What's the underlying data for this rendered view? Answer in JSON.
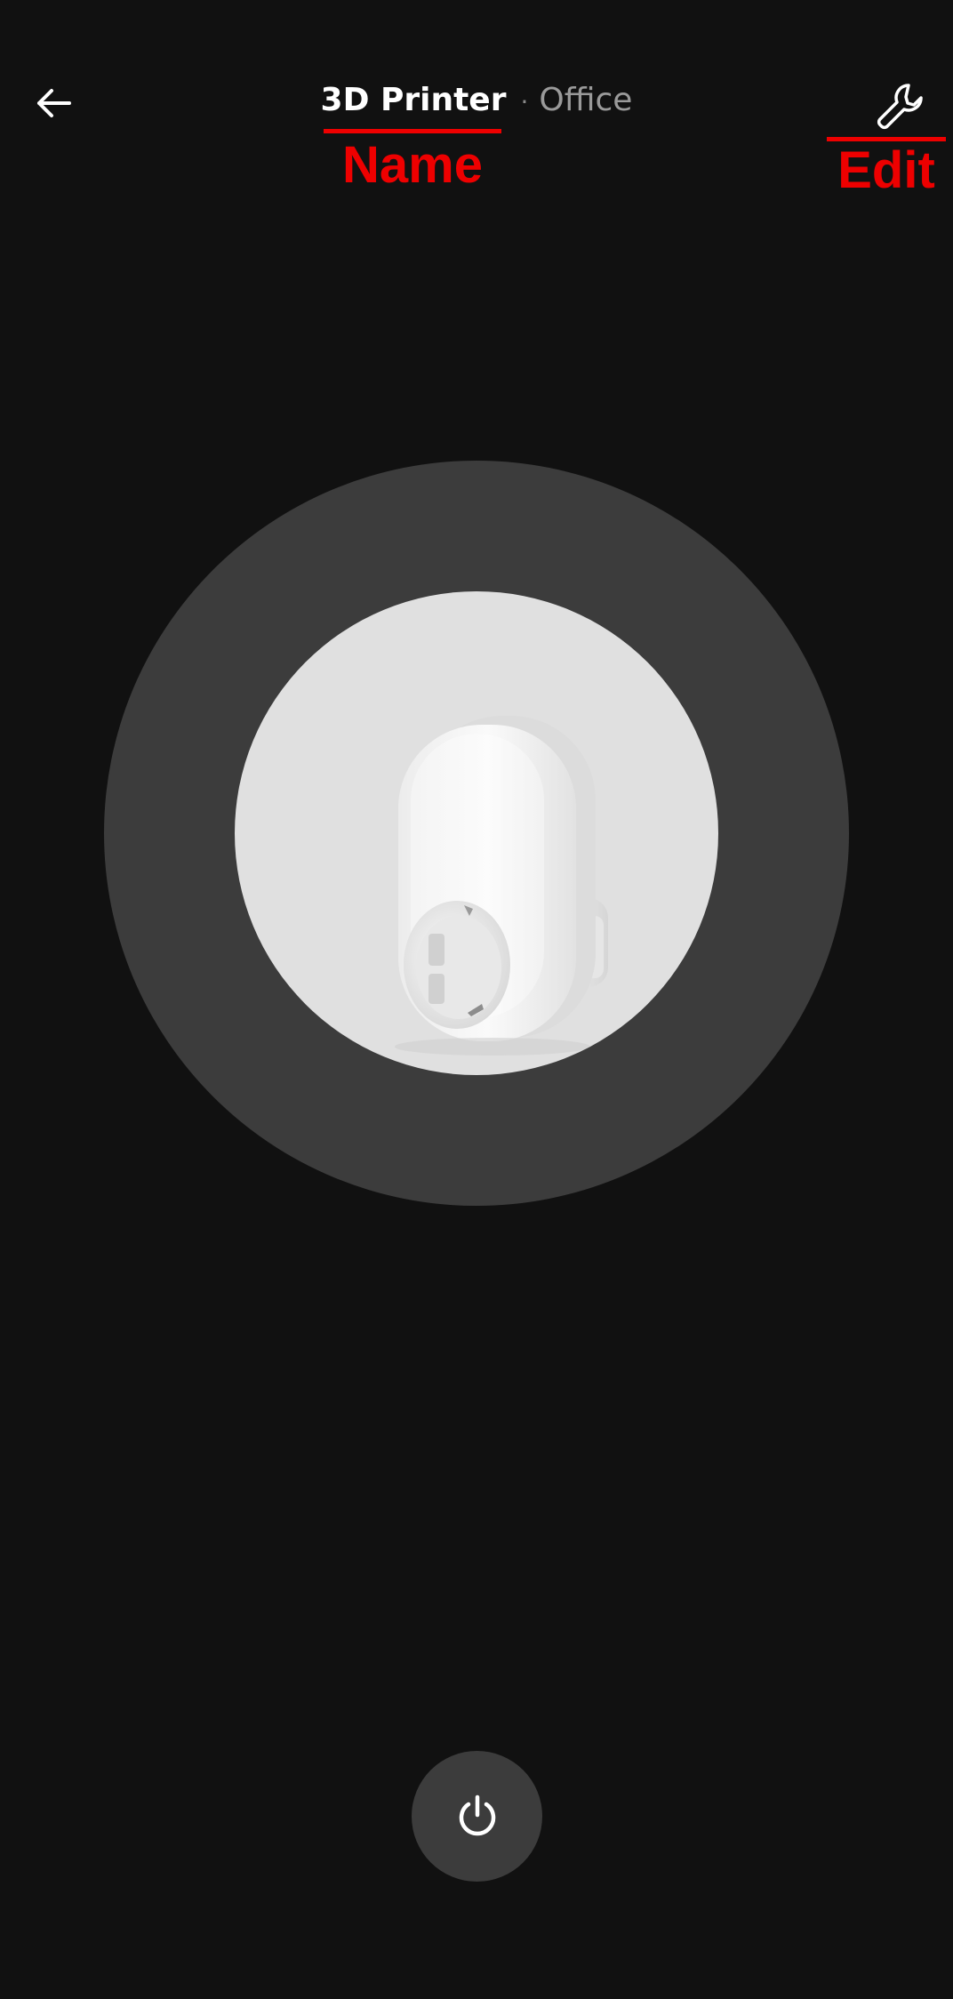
{
  "header": {
    "device_name": "3D Printer",
    "separator": "·",
    "room": "Office"
  },
  "annotations": {
    "name_label": "Name",
    "edit_label": "Edit",
    "color": "#ee0000"
  },
  "icons": {
    "back": "arrow-left-icon",
    "edit": "wrench-icon",
    "power": "power-icon"
  },
  "device": {
    "image": "smart-plug"
  },
  "colors": {
    "background": "#111111",
    "ring": "#3c3c3c",
    "inner": "#e0e0e0"
  }
}
